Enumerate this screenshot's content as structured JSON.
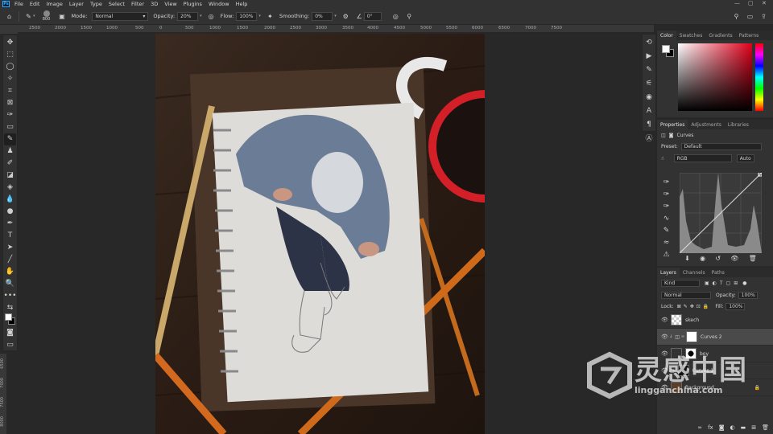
{
  "menu": {
    "app_icon": "Ps",
    "items": [
      "File",
      "Edit",
      "Image",
      "Layer",
      "Type",
      "Select",
      "Filter",
      "3D",
      "View",
      "Plugins",
      "Window",
      "Help"
    ]
  },
  "options": {
    "brush_size": "800",
    "mode_label": "Mode:",
    "mode_value": "Normal",
    "opacity_label": "Opacity:",
    "opacity_value": "20%",
    "flow_label": "Flow:",
    "flow_value": "100%",
    "smoothing_label": "Smoothing:",
    "smoothing_value": "0%",
    "angle_value": "0°"
  },
  "ruler": {
    "h_ticks": [
      "2500",
      "2000",
      "1500",
      "1000",
      "500",
      "0",
      "500",
      "1000",
      "1500",
      "2000",
      "2500",
      "3000",
      "3500",
      "4000",
      "4500",
      "5000",
      "5500",
      "6000",
      "6500",
      "7000",
      "7500"
    ],
    "v_ticks": [
      "6500",
      "7000",
      "7500",
      "8000"
    ]
  },
  "color_panel": {
    "tabs": [
      "Color",
      "Swatches",
      "Gradients",
      "Patterns"
    ],
    "hue_color": "#e0001b"
  },
  "properties_panel": {
    "tabs": [
      "Properties",
      "Adjustments",
      "Libraries"
    ],
    "adj_title": "Curves",
    "preset_label": "Preset:",
    "preset_value": "Default",
    "channel_value": "RGB",
    "auto_label": "Auto"
  },
  "layers_panel": {
    "tabs": [
      "Layers",
      "Channels",
      "Paths"
    ],
    "kind_label": "Kind",
    "blend_value": "Normal",
    "opacity_label": "Opacity:",
    "opacity_value": "100%",
    "lock_label": "Lock:",
    "fill_label": "Fill:",
    "fill_value": "100%",
    "layers": [
      {
        "name": "skech"
      },
      {
        "name": "Curves 2"
      },
      {
        "name": "boy"
      },
      {
        "name": "Curves 1"
      },
      {
        "name": "Background"
      }
    ]
  },
  "watermark": {
    "brand_cn": "灵感中国",
    "url": "lingganchina.com"
  }
}
